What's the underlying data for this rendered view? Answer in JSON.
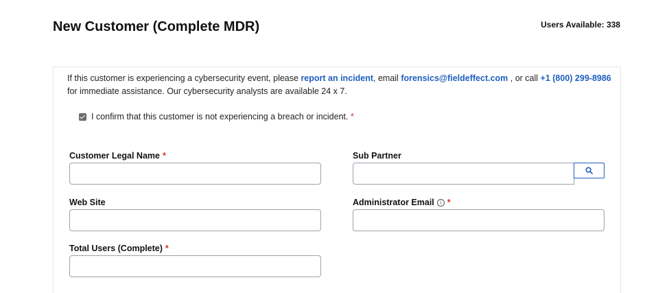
{
  "header": {
    "title": "New Customer (Complete MDR)",
    "users_available": "Users Available: 338"
  },
  "notice": {
    "text_before": "If this customer is experiencing a cybersecurity event, please ",
    "report_link": "report an incident",
    "text_email": ", email ",
    "email_link": "forensics@fieldeffect.com",
    "text_call": " , or call ",
    "phone_link": "+1 (800) 299-8986",
    "text_after": " for immediate assistance. Our cybersecurity analysts are available 24 x 7."
  },
  "confirm": {
    "label": "I confirm that this customer is not experiencing a breach or incident.",
    "checked": true,
    "required_mark": "*"
  },
  "fields": {
    "customer_legal_name": {
      "label": "Customer Legal Name",
      "required_mark": "*",
      "value": ""
    },
    "sub_partner": {
      "label": "Sub Partner",
      "value": "",
      "button_icon": "search-icon"
    },
    "web_site": {
      "label": "Web Site",
      "value": ""
    },
    "administrator_email": {
      "label": "Administrator Email",
      "info_icon": "i",
      "required_mark": "*",
      "value": ""
    },
    "total_users": {
      "label": "Total Users (Complete)",
      "required_mark": "*",
      "value": ""
    }
  },
  "colors": {
    "link": "#1f5fbf",
    "required": "#d32f2f",
    "input_border": "#9aa3ad"
  }
}
